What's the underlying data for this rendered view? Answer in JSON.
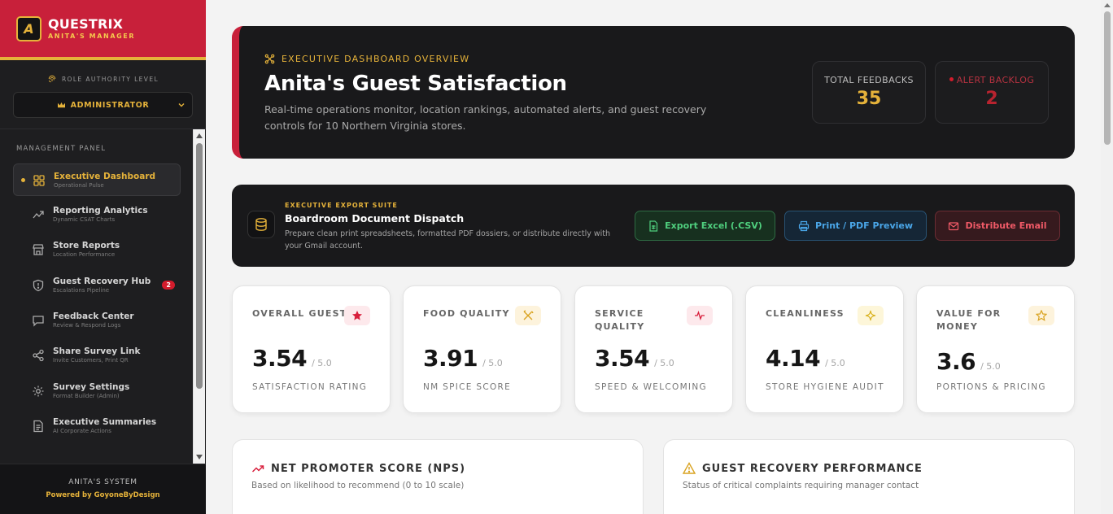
{
  "brand": {
    "logo_letter": "A",
    "name": "QUESTRIX",
    "sub": "ANITA'S MANAGER"
  },
  "role": {
    "label": "ROLE AUTHORITY LEVEL",
    "selected": "ADMINISTRATOR"
  },
  "nav": {
    "heading": "MANAGEMENT PANEL",
    "items": [
      {
        "title": "Executive Dashboard",
        "sub": "Operational Pulse",
        "icon": "grid-icon",
        "active": true
      },
      {
        "title": "Reporting Analytics",
        "sub": "Dynamic CSAT Charts",
        "icon": "trend-icon"
      },
      {
        "title": "Store Reports",
        "sub": "Location Performance",
        "icon": "store-icon"
      },
      {
        "title": "Guest Recovery Hub",
        "sub": "Escalations Pipeline",
        "icon": "shield-icon",
        "badge": "2"
      },
      {
        "title": "Feedback Center",
        "sub": "Review & Respond Logs",
        "icon": "chat-icon"
      },
      {
        "title": "Share Survey Link",
        "sub": "Invite Customers, Print QR",
        "icon": "share-icon"
      },
      {
        "title": "Survey Settings",
        "sub": "Format Builder (Admin)",
        "icon": "gear-icon"
      },
      {
        "title": "Executive Summaries",
        "sub": "AI Corporate Actions",
        "icon": "document-icon"
      }
    ]
  },
  "footer": {
    "system": "ANITA'S SYSTEM",
    "powered": "Powered by GoyoneByDesign"
  },
  "hero": {
    "eyebrow": "EXECUTIVE DASHBOARD OVERVIEW",
    "title": "Anita's Guest Satisfaction",
    "description": "Real-time operations monitor, location rankings, automated alerts, and guest recovery controls for 10 Northern Virginia stores.",
    "total_label": "TOTAL FEEDBACKS",
    "total_value": "35",
    "alert_label": "ALERT BACKLOG",
    "alert_value": "2"
  },
  "export": {
    "eyebrow": "EXECUTIVE EXPORT SUITE",
    "title": "Boardroom Document Dispatch",
    "description": "Prepare clean print spreadsheets, formatted PDF dossiers, or distribute directly with your Gmail account.",
    "csv_label": "Export Excel (.CSV)",
    "pdf_label": "Print / PDF Preview",
    "email_label": "Distribute Email"
  },
  "metrics": [
    {
      "label": "OVERALL GUEST",
      "value": "3.54",
      "max": "/ 5.0",
      "sub": "SATISFACTION RATING",
      "icon": "star-icon"
    },
    {
      "label": "FOOD QUALITY",
      "value": "3.91",
      "max": "/ 5.0",
      "sub": "NM SPICE SCORE",
      "icon": "utensils-icon"
    },
    {
      "label": "SERVICE QUALITY",
      "value": "3.54",
      "max": "/ 5.0",
      "sub": "SPEED & WELCOMING",
      "icon": "pulse-icon"
    },
    {
      "label": "CLEANLINESS",
      "value": "4.14",
      "max": "/ 5.0",
      "sub": "STORE HYGIENE AUDIT",
      "icon": "sparkle-icon"
    },
    {
      "label": "VALUE FOR MONEY",
      "value": "3.6",
      "max": "/ 5.0",
      "sub": "PORTIONS & PRICING",
      "icon": "star-outline-icon"
    }
  ],
  "panels": {
    "nps_title": "NET PROMOTER SCORE (NPS)",
    "nps_desc": "Based on likelihood to recommend (0 to 10 scale)",
    "recovery_title": "GUEST RECOVERY PERFORMANCE",
    "recovery_desc": "Status of critical complaints requiring manager contact"
  },
  "colors": {
    "brand_red": "#c8203a",
    "gold": "#e5b23a",
    "dark": "#19191b"
  }
}
